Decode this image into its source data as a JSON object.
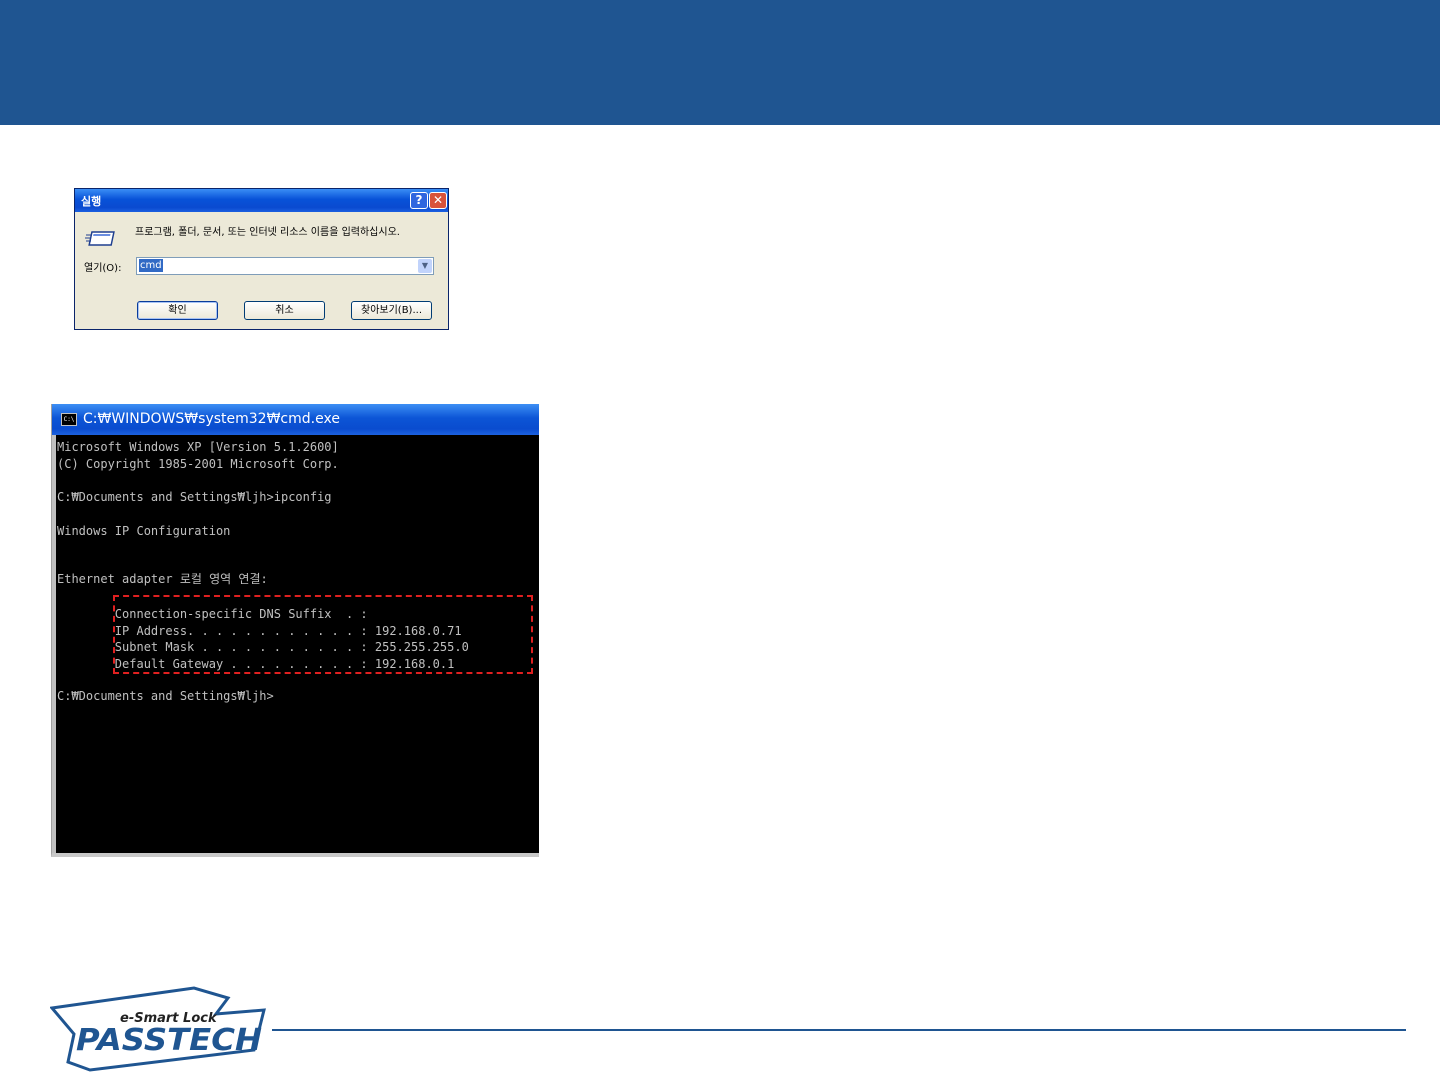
{
  "run_dialog": {
    "title": "실행",
    "help_button": "?",
    "close_button": "✕",
    "prompt": "프로그램, 폴더, 문서, 또는 인터넷 리소스 이름을 입력하십시오.",
    "open_label": "열기(O):",
    "open_value": "cmd",
    "ok_label": "확인",
    "cancel_label": "취소",
    "browse_label": "찾아보기(B)..."
  },
  "cmd_window": {
    "title": "C:₩WINDOWS₩system32₩cmd.exe",
    "icon_text": "C:\\",
    "lines": [
      "Microsoft Windows XP [Version 5.1.2600]",
      "(C) Copyright 1985-2001 Microsoft Corp.",
      "C:₩Documents and Settings₩ljh>ipconfig",
      "Windows IP Configuration",
      "Ethernet adapter 로컬 영역 연결:",
      "        Connection-specific DNS Suffix  . :",
      "        IP Address. . . . . . . . . . . . : 192.168.0.71",
      "        Subnet Mask . . . . . . . . . . . : 255.255.255.0",
      "        Default Gateway . . . . . . . . . : 192.168.0.1",
      "C:₩Documents and Settings₩ljh>"
    ]
  },
  "logo": {
    "tagline": "e-Smart Lock",
    "brand": "PASSTECH"
  },
  "colors": {
    "banner": "#1f5591",
    "highlight_border": "#e02020"
  }
}
